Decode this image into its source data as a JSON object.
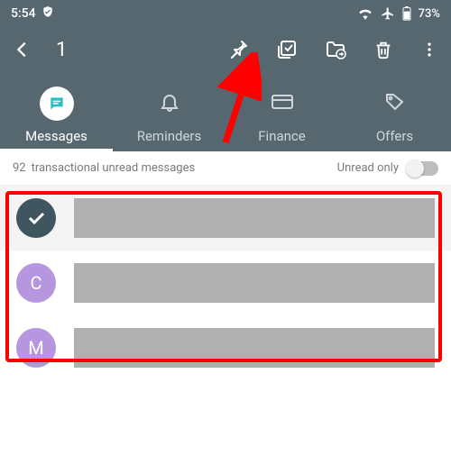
{
  "status": {
    "time": "5:54",
    "battery": "73%"
  },
  "actionBar": {
    "selectedCount": "1"
  },
  "tabs": {
    "messages": "Messages",
    "reminders": "Reminders",
    "finance": "Finance",
    "offers": "Offers"
  },
  "filter": {
    "count": "92",
    "label": "transactional unread messages",
    "toggleLabel": "Unread only"
  },
  "rows": {
    "r1": {
      "avatar": "C"
    },
    "r2": {
      "avatar": "M"
    }
  }
}
